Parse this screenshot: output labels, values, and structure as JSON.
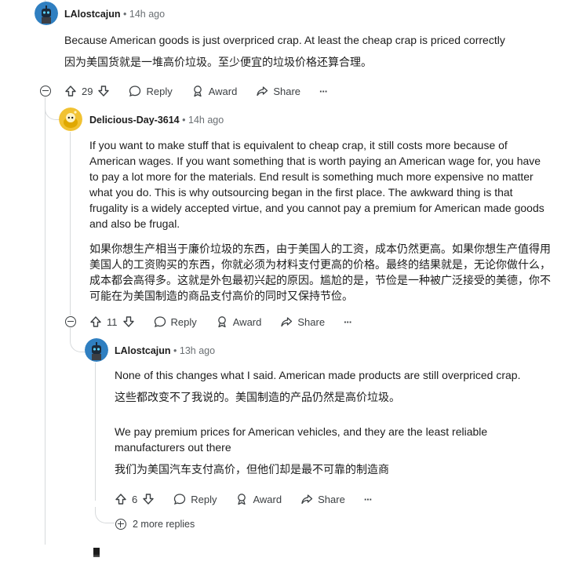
{
  "comments": [
    {
      "user": "LAlostcajun",
      "time": "14h ago",
      "text_en": "Because American goods is just overpriced crap. At least the cheap crap is priced correctly",
      "text_zh": "因为美国货就是一堆高价垃圾。至少便宜的垃圾价格还算合理。",
      "votes": "29"
    },
    {
      "user": "Delicious-Day-3614",
      "time": "14h ago",
      "text_en": "If you want to make stuff that is equivalent to cheap crap, it still costs more because of American wages. If you want something that is worth paying an American wage for, you have to pay a lot more for the materials. End result is something much more expensive no matter what you do. This is why outsourcing began in the first place. The awkward thing is that frugality is a widely accepted virtue, and you cannot pay a premium for American made goods and also be frugal.",
      "text_zh": "如果你想生产相当于廉价垃圾的东西，由于美国人的工资，成本仍然更高。如果你想生产值得用美国人的工资购买的东西，你就必须为材料支付更高的价格。最终的结果就是，无论你做什么，成本都会高得多。这就是外包最初兴起的原因。尴尬的是，节俭是一种被广泛接受的美德，你不可能在为美国制造的商品支付高价的同时又保持节俭。",
      "votes": "11"
    },
    {
      "user": "LAlostcajun",
      "time": "13h ago",
      "text_en": "None of this changes what I said. American made products are still overpriced crap.",
      "text_zh": "这些都改变不了我说的。美国制造的产品仍然是高价垃圾。",
      "text_en_2": "We pay premium prices for American vehicles, and they are the least reliable manufacturers out there",
      "text_zh_2": "我们为美国汽车支付高价，但他们却是最不可靠的制造商",
      "votes": "6"
    }
  ],
  "dot": "•",
  "actions": {
    "reply": "Reply",
    "award": "Award",
    "share": "Share",
    "more": "···"
  },
  "more_replies": "2 more replies",
  "colors": {
    "thread_line": "#d7dadc",
    "avatar_blue": "#2f7fc1",
    "avatar_yellow": "#f1c232",
    "meta_gray": "#6a6f73"
  }
}
